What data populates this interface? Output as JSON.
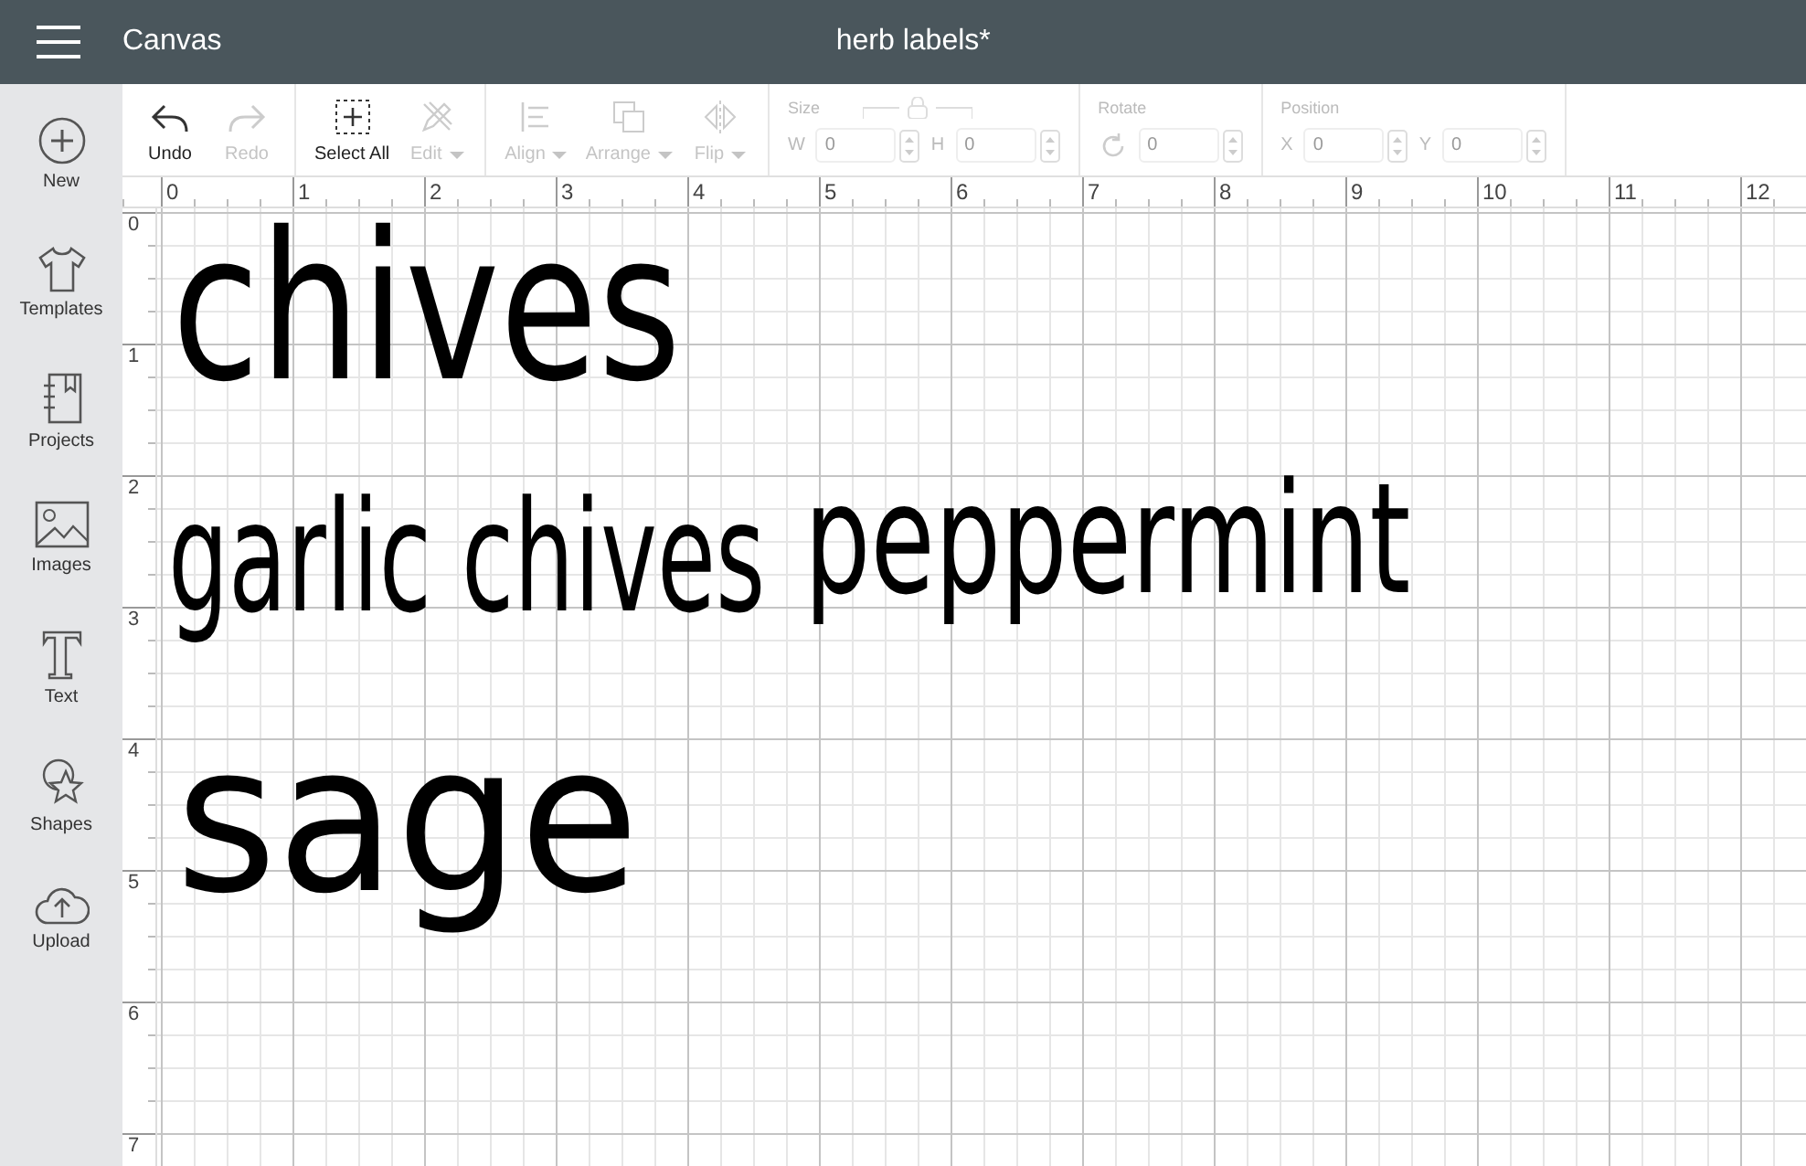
{
  "header": {
    "app_title": "Canvas",
    "document_title": "herb labels*"
  },
  "sidebar": {
    "items": [
      {
        "label": "New",
        "kind": "new"
      },
      {
        "label": "Templates",
        "kind": "templates"
      },
      {
        "label": "Projects",
        "kind": "projects"
      },
      {
        "label": "Images",
        "kind": "images"
      },
      {
        "label": "Text",
        "kind": "text"
      },
      {
        "label": "Shapes",
        "kind": "shapes"
      },
      {
        "label": "Upload",
        "kind": "upload"
      }
    ]
  },
  "toolbar": {
    "groups": [
      {
        "buttons": [
          {
            "label": "Undo",
            "kind": "undo",
            "disabled": false,
            "has_menu": false
          },
          {
            "label": "Redo",
            "kind": "redo",
            "disabled": true,
            "has_menu": false
          }
        ]
      },
      {
        "buttons": [
          {
            "label": "Select All",
            "kind": "select",
            "disabled": false,
            "has_menu": false
          },
          {
            "label": "Edit",
            "kind": "edit",
            "disabled": true,
            "has_menu": true
          }
        ]
      },
      {
        "buttons": [
          {
            "label": "Align",
            "kind": "align",
            "disabled": true,
            "has_menu": true
          },
          {
            "label": "Arrange",
            "kind": "arrange",
            "disabled": true,
            "has_menu": true
          },
          {
            "label": "Flip",
            "kind": "flip",
            "disabled": true,
            "has_menu": true
          }
        ]
      }
    ],
    "fieldsets": [
      {
        "title": "Size",
        "kind": "size",
        "fields": [
          {
            "label": "W",
            "value": "0"
          },
          {
            "label": "H",
            "value": "0"
          }
        ]
      },
      {
        "title": "Rotate",
        "kind": "rotate",
        "fields": [
          {
            "value": "0"
          }
        ]
      },
      {
        "title": "Position",
        "kind": "position",
        "fields": [
          {
            "label": "X",
            "value": "0"
          },
          {
            "label": "Y",
            "value": "0"
          }
        ]
      }
    ]
  },
  "rulers": {
    "horizontal": [
      "0",
      "1",
      "2",
      "3",
      "4",
      "5",
      "6",
      "7",
      "8",
      "9",
      "10",
      "11",
      "12"
    ],
    "vertical": [
      "0",
      "1",
      "2",
      "3",
      "4",
      "5",
      "6",
      "7"
    ]
  },
  "canvas": {
    "texts": [
      {
        "text": "chives"
      },
      {
        "text": "garlic chives"
      },
      {
        "text": "peppermint"
      },
      {
        "text": "sage"
      }
    ]
  }
}
